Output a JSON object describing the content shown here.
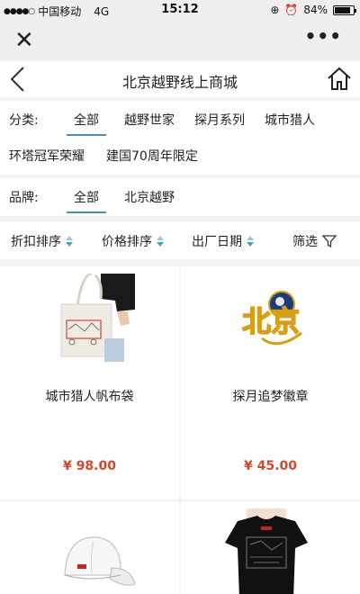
{
  "status": {
    "carrier": "中国移动",
    "network": "4G",
    "time": "15:12",
    "battery": "84%",
    "battery_level": 0.84
  },
  "header": {
    "title": "北京越野线上商城"
  },
  "category": {
    "label": "分类:",
    "options": [
      "全部",
      "越野世家",
      "探月系列",
      "城市猎人",
      "环塔冠军荣耀",
      "建国70周年限定"
    ],
    "active": "全部"
  },
  "brand": {
    "label": "品牌:",
    "options": [
      "全部",
      "北京越野"
    ],
    "active": "全部"
  },
  "sort": {
    "discount": "折扣排序",
    "price": "价格排序",
    "date": "出厂日期",
    "filter": "筛选"
  },
  "products": [
    {
      "name": "城市猎人帆布袋",
      "price": "¥ 98.00",
      "image": "tote-bag"
    },
    {
      "name": "探月追梦徽章",
      "price": "¥ 45.00",
      "image": "badge"
    },
    {
      "name": "",
      "price": "",
      "image": "cap"
    },
    {
      "name": "",
      "price": "",
      "image": "t-shirt"
    }
  ],
  "badge_text": "北京",
  "colors": {
    "accent": "#4a8fa8",
    "price": "#d0482a",
    "badge_red": "#c8251f"
  }
}
